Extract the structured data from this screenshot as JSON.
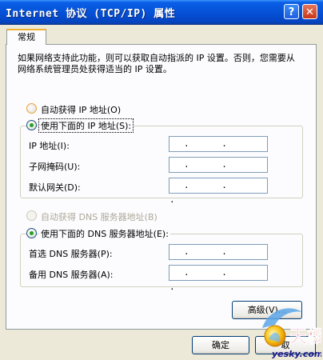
{
  "window": {
    "title": "Internet 协议 (TCP/IP) 属性",
    "help_glyph": "?",
    "close_glyph": "✕"
  },
  "tabs": [
    {
      "label": "常规"
    }
  ],
  "description": "如果网络支持此功能，则可以获取自动指派的 IP 设置。否则，您需要从网络系统管理员处获得适当的 IP 设置。",
  "ip_section": {
    "auto_label": "自动获得 IP 地址(O)",
    "manual_label": "使用下面的 IP 地址(S):",
    "selected": "manual",
    "fields": [
      {
        "label": "IP 地址(I):",
        "value": ". . ."
      },
      {
        "label": "子网掩码(U):",
        "value": ". . ."
      },
      {
        "label": "默认网关(D):",
        "value": ". . ."
      }
    ]
  },
  "dns_section": {
    "auto_label": "自动获得 DNS 服务器地址(B)",
    "manual_label": "使用下面的 DNS 服务器地址(E):",
    "selected": "manual",
    "fields": [
      {
        "label": "首选 DNS 服务器(P):",
        "value": ". . ."
      },
      {
        "label": "备用 DNS 服务器(A):",
        "value": ". . ."
      }
    ]
  },
  "buttons": {
    "advanced": "高级(V)...",
    "ok": "确定",
    "cancel": "取"
  },
  "watermark": {
    "brand": "天极",
    "url": "yesky.com"
  },
  "colors": {
    "titlebar": "#0552d8",
    "radio_selected": "#21a121",
    "dialog_bg": "#ece9d8"
  }
}
